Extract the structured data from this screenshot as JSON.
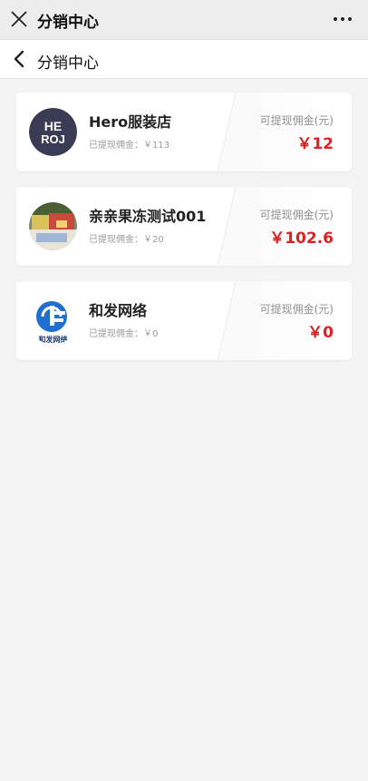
{
  "topbar": {
    "title": "分销中心"
  },
  "navbar": {
    "title": "分销中心"
  },
  "shops": [
    {
      "name": "Hero服装店",
      "withdrawn": "已提现佣金：￥113",
      "available_label": "可提现佣金(元)",
      "available": "￥12",
      "logo_text": "HE-ROJ"
    },
    {
      "name": "亲亲果冻测试001",
      "withdrawn": "已提现佣金：￥20",
      "available_label": "可提现佣金(元)",
      "available": "￥102.6",
      "logo_text": ""
    },
    {
      "name": "和发网络",
      "withdrawn": "已提现佣金：￥0",
      "available_label": "可提现佣金(元)",
      "available": "￥0",
      "logo_text": "和发网络"
    }
  ],
  "colors": {
    "accent": "#e02020",
    "background": "#f4f4f4"
  }
}
